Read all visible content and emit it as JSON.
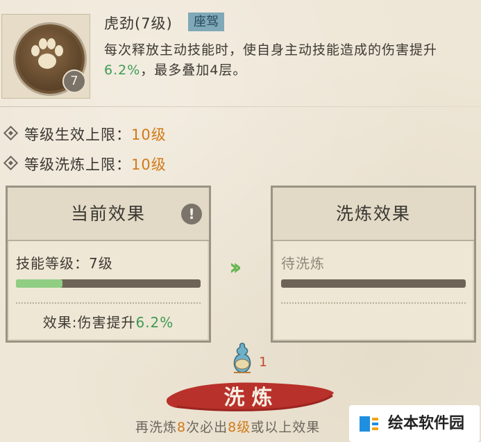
{
  "skill": {
    "name": "虎劲(7级)",
    "tag": "座驾",
    "level_badge": "7",
    "desc_part1": "每次释放主动技能时，使自身主动技能造成的伤害提升",
    "desc_value": "6.2%",
    "desc_part2": "，最多叠加4层。",
    "icon": "paw-icon"
  },
  "limits": [
    {
      "label": "等级生效上限：",
      "value": "10级"
    },
    {
      "label": "等级洗炼上限：",
      "value": "10级"
    }
  ],
  "current_panel": {
    "title": "当前效果",
    "skill_level_label": "技能等级：7级",
    "progress": 0.25,
    "effect_prefix": "效果:伤害提升",
    "effect_value": "6.2%"
  },
  "wash_panel": {
    "title": "洗炼效果",
    "pending_label": "待洗炼"
  },
  "cost": {
    "item_icon": "gourd-icon",
    "count": "1"
  },
  "wash_button": {
    "label": "洗炼"
  },
  "guarantee": {
    "part1": "再洗炼",
    "times": "8",
    "part2": "次必出",
    "level": "8级",
    "part3": "或以上效果"
  },
  "watermark": {
    "text": "绘本软件园"
  },
  "colors": {
    "green": "#3f9a55",
    "orange": "#d17a18",
    "progress": "#8fce83",
    "button": "#b8312a"
  }
}
